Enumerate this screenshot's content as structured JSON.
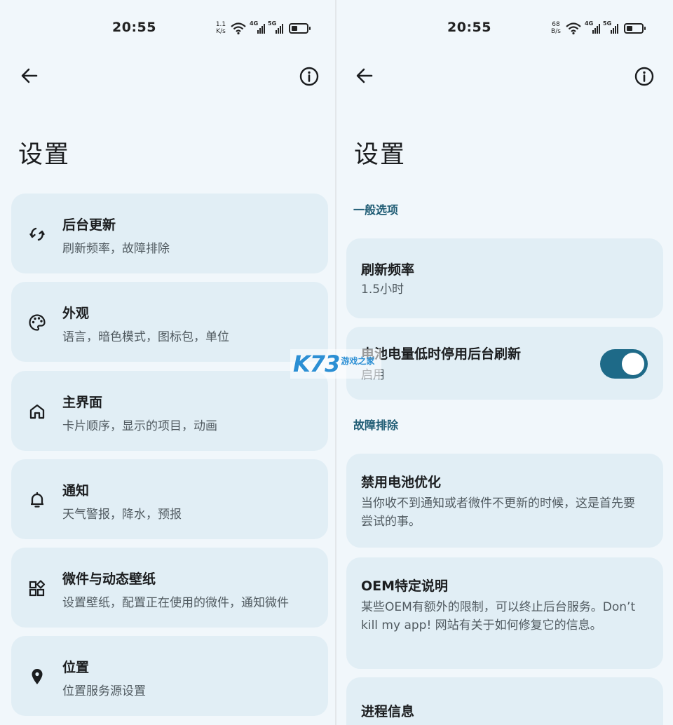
{
  "left": {
    "status": {
      "time": "20:55",
      "speed_value": "1.1",
      "speed_unit": "K/s",
      "sig1": "4G",
      "sig2": "5G"
    },
    "title": "设置",
    "items": [
      {
        "title": "后台更新",
        "subtitle": "刷新频率，故障排除",
        "icon": "sync-icon"
      },
      {
        "title": "外观",
        "subtitle": "语言，暗色模式，图标包，单位",
        "icon": "palette-icon"
      },
      {
        "title": "主界面",
        "subtitle": "卡片顺序，显示的项目，动画",
        "icon": "home-icon"
      },
      {
        "title": "通知",
        "subtitle": "天气警报，降水，预报",
        "icon": "bell-icon"
      },
      {
        "title": "微件与动态壁纸",
        "subtitle": "设置壁纸，配置正在使用的微件，通知微件",
        "icon": "widgets-icon"
      },
      {
        "title": "位置",
        "subtitle": "位置服务源设置",
        "icon": "location-pin-icon"
      }
    ]
  },
  "right": {
    "status": {
      "time": "20:55",
      "speed_value": "68",
      "speed_unit": "B/s",
      "sig1": "4G",
      "sig2": "5G"
    },
    "title": "设置",
    "section_general": "一般选项",
    "refresh": {
      "title": "刷新频率",
      "subtitle": "1.5小时"
    },
    "battery": {
      "title": "电池电量低时停用后台刷新",
      "subtitle": "启用",
      "enabled": true
    },
    "section_trouble": "故障排除",
    "disable_opt": {
      "title": "禁用电池优化",
      "subtitle": "当你收不到通知或者微件不更新的时候，这是首先要尝试的事。"
    },
    "oem": {
      "title": "OEM特定说明",
      "subtitle": "某些OEM有额外的限制，可以终止后台服务。Don’t kill my app! 网站有关于如何修复它的信息。"
    },
    "process": {
      "title": "进程信息"
    }
  },
  "watermark": {
    "brand": "K73",
    "text": "游戏之家"
  },
  "colors": {
    "accent": "#1e6a88",
    "card": "#e1eef5",
    "background": "#f1f7fb",
    "section": "#1f5c74"
  }
}
